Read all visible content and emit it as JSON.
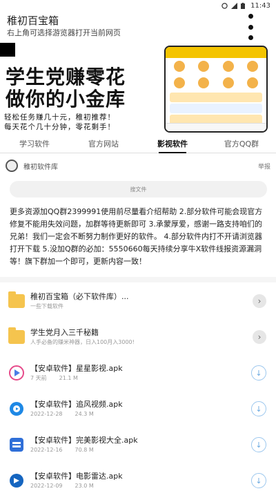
{
  "status_bar": {
    "time": "11:43"
  },
  "header": {
    "title": "稚初百宝箱",
    "subtitle": "右上角可选择游览器打开当前网页"
  },
  "banner": {
    "line1": "学生党赚零花",
    "line2": "做你的小金库",
    "tag1": "轻松任务赚几十元，稚初推荐！",
    "tag2": "每天花个几十分钟，零花剩手！"
  },
  "tabs": [
    {
      "label": "学习软件"
    },
    {
      "label": "官方网站"
    },
    {
      "label": "影视软件"
    },
    {
      "label": "官方QQ群"
    }
  ],
  "library": {
    "name": "稚初软件库",
    "report": "举报"
  },
  "search": {
    "placeholder": "搜文件"
  },
  "notice": "更多资源加QQ群2399991使用前尽量看介绍帮助 2.部分软件可能会现官方修复不能用失效问题，加群等待更新即可 3.承蒙厚爱，感谢一路支持咱们的兄弟！我们一定会不断努力制作更好的软件。 4.部分软件内打不开请浏览器打开下载 5.没加Q群的必加：5550660每天持续分享牛X软件线报资源漏洞等！旗下群加一个即可，更新内容一致！",
  "items": [
    {
      "title": "稚初百宝箱（必下软件库）...",
      "sub": "一些下载软件",
      "size": ""
    },
    {
      "title": "学生党月入三千秘籍",
      "sub": "人手必备的赚米神器，日入100月入3000!",
      "size": ""
    },
    {
      "title": "【安卓软件】星星影视.apk",
      "sub": "7 天前",
      "size": "21.1 M"
    },
    {
      "title": "【安卓软件】追风视频.apk",
      "sub": "2022-12-28",
      "size": "24.3 M"
    },
    {
      "title": "【安卓软件】完美影视大全.apk",
      "sub": "2022-12-16",
      "size": "70.8 M"
    },
    {
      "title": "【安卓软件】电影雷达.apk",
      "sub": "2022-12-09",
      "size": "23.0 M"
    }
  ],
  "icons": {
    "folder": "folder-icon",
    "arrow": "chevron-right-icon",
    "download": "download-icon"
  },
  "colors": {
    "folder": "#f5c44e",
    "banner_top": "#f4c400",
    "download": "#6aa9e0"
  }
}
